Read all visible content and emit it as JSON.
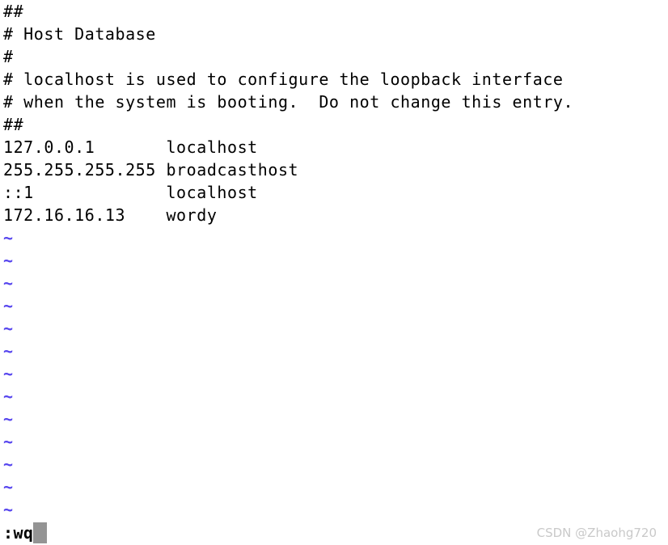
{
  "editor": {
    "name": "vim",
    "mode": "command",
    "colors": {
      "background": "#ffffff",
      "foreground": "#000000",
      "tilde": "#5544ee",
      "cursor": "#949494",
      "watermark": "#c9c9c9"
    }
  },
  "buffer": {
    "lines": [
      "##",
      "# Host Database",
      "#",
      "# localhost is used to configure the loopback interface",
      "# when the system is booting.  Do not change this entry.",
      "##",
      "127.0.0.1       localhost",
      "255.255.255.255 broadcasthost",
      "::1             localhost",
      "172.16.16.13    wordy"
    ],
    "empty_marker": "~",
    "empty_marker_count": 13
  },
  "hosts_entries": [
    {
      "address": "127.0.0.1",
      "hostname": "localhost"
    },
    {
      "address": "255.255.255.255",
      "hostname": "broadcasthost"
    },
    {
      "address": "::1",
      "hostname": "localhost"
    },
    {
      "address": "172.16.16.13",
      "hostname": "wordy"
    }
  ],
  "status": {
    "command": ":wq",
    "cursor": ""
  },
  "watermark": {
    "text": "CSDN @Zhaohg720"
  }
}
